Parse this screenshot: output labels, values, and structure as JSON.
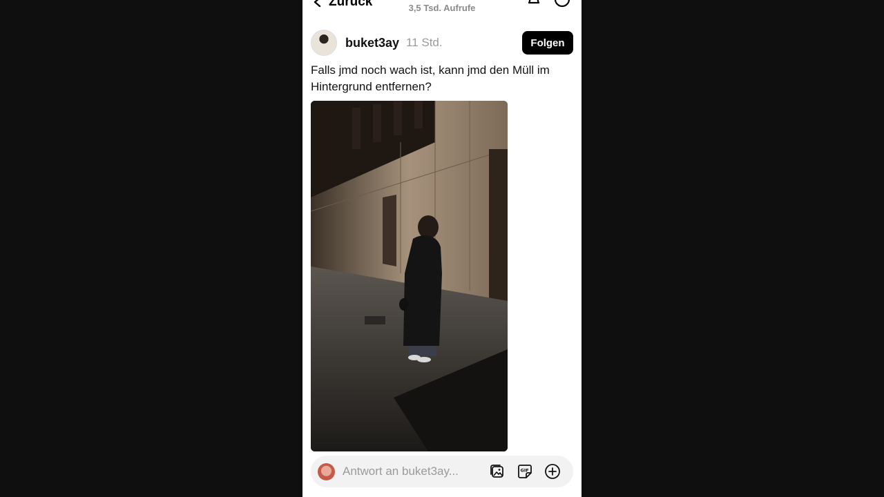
{
  "header": {
    "back_label": "Zurück",
    "views": "3,5 Tsd. Aufrufe"
  },
  "post": {
    "username": "buket3ay",
    "time": "11 Std.",
    "follow_label": "Folgen",
    "caption": "Falls jmd noch wach ist, kann jmd den Müll im Hintergrund entfernen?",
    "photo": "photo of a person in a long black coat standing by a stone building at night"
  },
  "reply": {
    "placeholder": "Antwort an buket3ay..."
  },
  "icons": {
    "back": "chevron-left-icon",
    "bell": "bell-icon",
    "more": "more-icon",
    "gallery": "gallery-icon",
    "gif": "gif-icon",
    "add": "plus-circle-icon"
  },
  "colors": {
    "follow_bg": "#000000",
    "muted_text": "#9a9a9a",
    "reply_bg": "#f2f2f2"
  }
}
